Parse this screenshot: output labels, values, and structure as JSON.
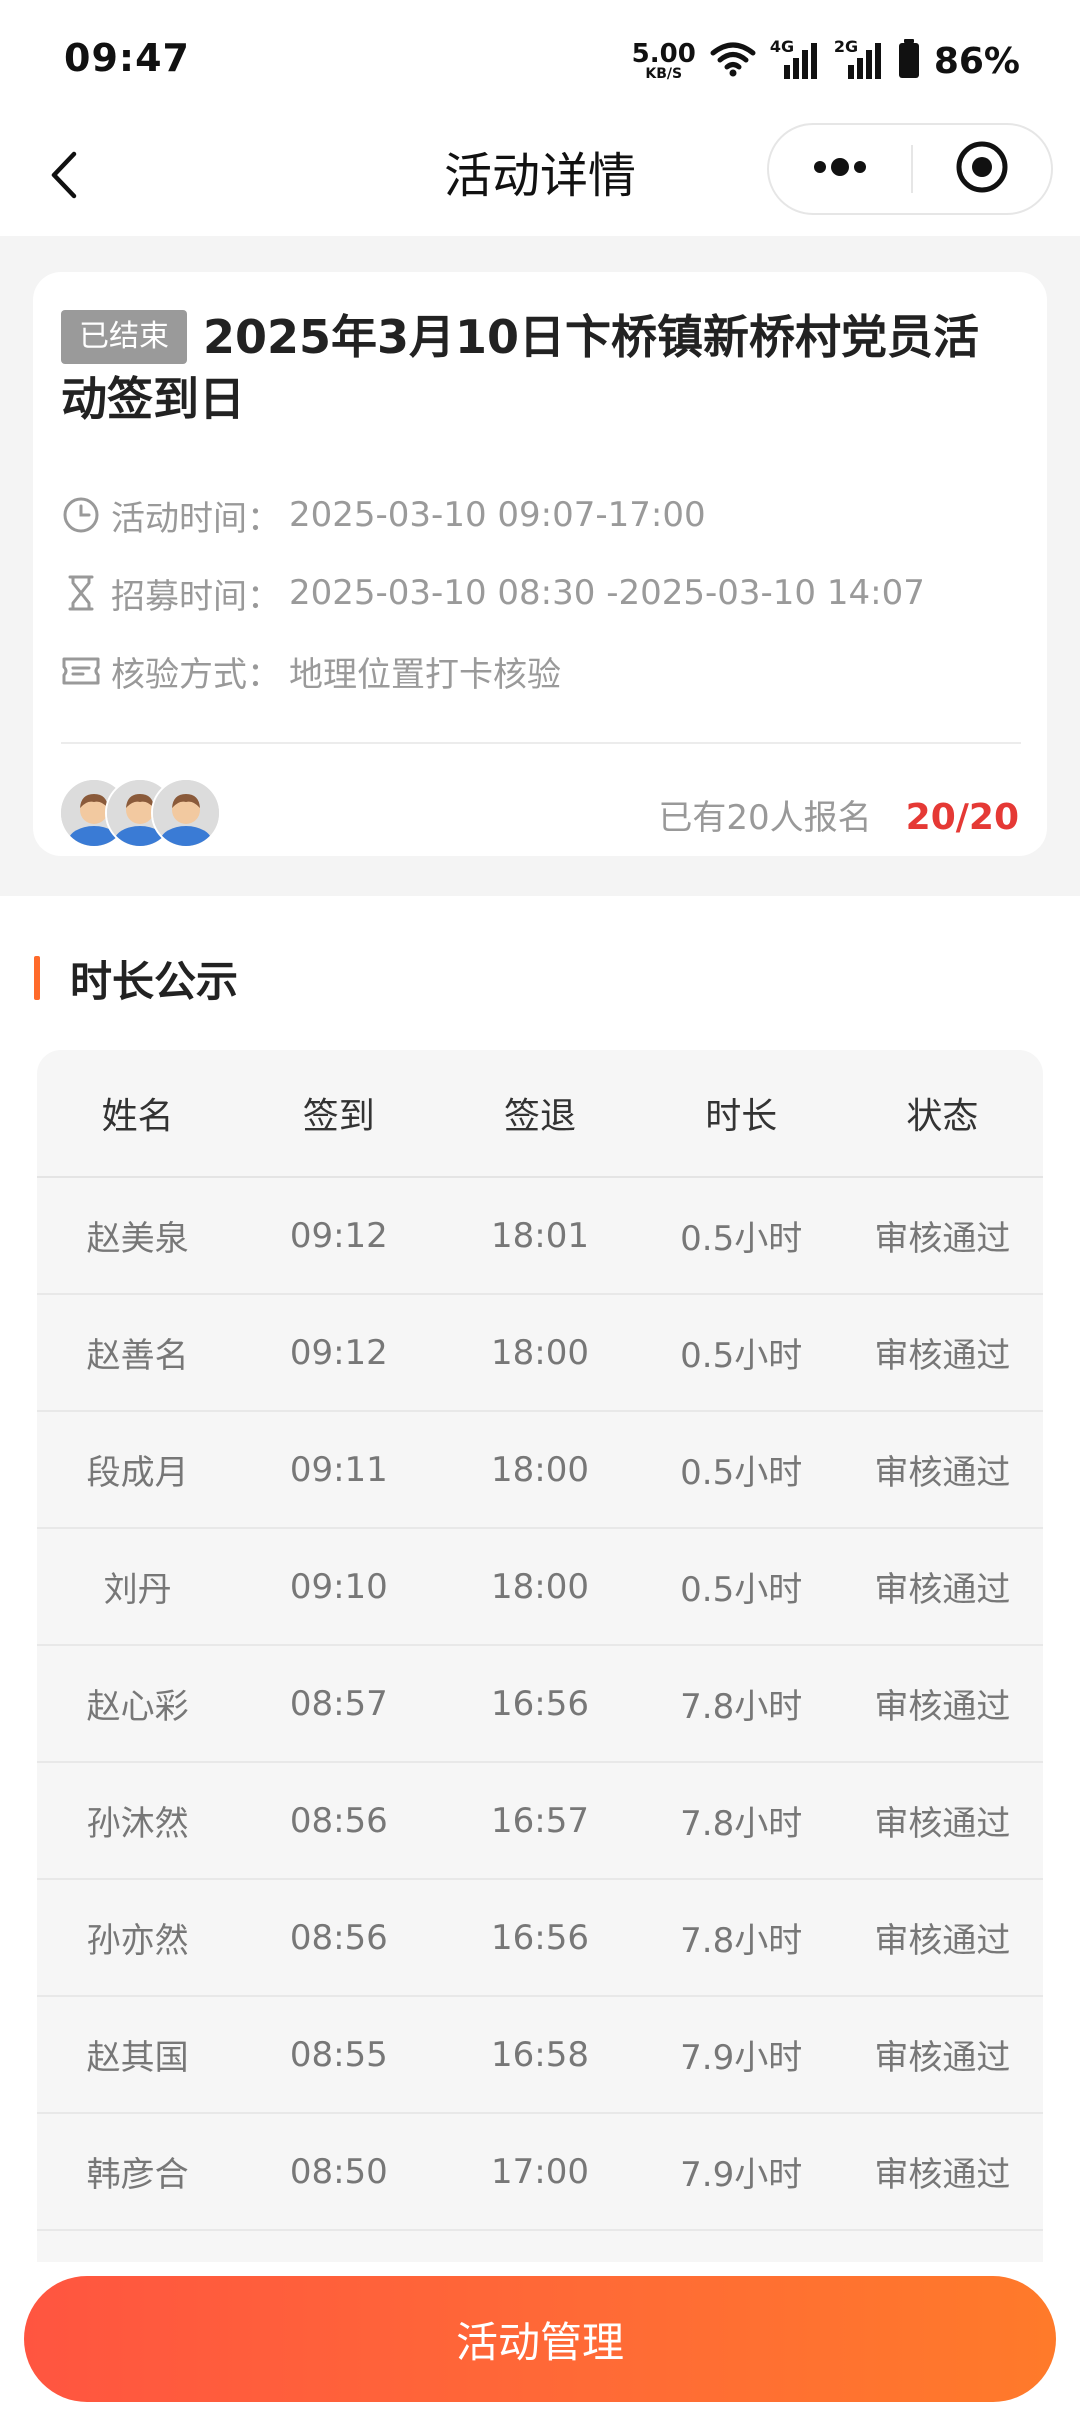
{
  "status_bar": {
    "time": "09:47",
    "net_speed": "5.00",
    "net_unit": "KB/S",
    "sig1": "4G",
    "sig2": "2G",
    "battery": "86%"
  },
  "nav": {
    "title": "活动详情",
    "back_icon": "chevron-left-icon",
    "more_icon": "more-dots-icon",
    "target_icon": "target-icon"
  },
  "activity": {
    "badge": "已结束",
    "title": "2025年3月10日卞桥镇新桥村党员活动签到日",
    "rows": [
      {
        "icon": "clock-icon",
        "label": "活动时间：",
        "value": "2025-03-10 09:07-17:00"
      },
      {
        "icon": "hourglass-icon",
        "label": "招募时间：",
        "value": "2025-03-10 08:30 -2025-03-10 14:07"
      },
      {
        "icon": "ticket-icon",
        "label": "核验方式：",
        "value": "地理位置打卡核验"
      }
    ],
    "signup_text": "已有20人报名",
    "signup_count": "20/20"
  },
  "section": {
    "title": "时长公示"
  },
  "table": {
    "headers": [
      "姓名",
      "签到",
      "签退",
      "时长",
      "状态"
    ],
    "rows": [
      [
        "赵美泉",
        "09:12",
        "18:01",
        "0.5小时",
        "审核通过"
      ],
      [
        "赵善名",
        "09:12",
        "18:00",
        "0.5小时",
        "审核通过"
      ],
      [
        "段成月",
        "09:11",
        "18:00",
        "0.5小时",
        "审核通过"
      ],
      [
        "刘丹",
        "09:10",
        "18:00",
        "0.5小时",
        "审核通过"
      ],
      [
        "赵心彩",
        "08:57",
        "16:56",
        "7.8小时",
        "审核通过"
      ],
      [
        "孙沐然",
        "08:56",
        "16:57",
        "7.8小时",
        "审核通过"
      ],
      [
        "孙亦然",
        "08:56",
        "16:56",
        "7.8小时",
        "审核通过"
      ],
      [
        "赵其国",
        "08:55",
        "16:58",
        "7.9小时",
        "审核通过"
      ],
      [
        "韩彦合",
        "08:50",
        "17:00",
        "7.9小时",
        "审核通过"
      ]
    ]
  },
  "bottom": {
    "button_label": "活动管理"
  },
  "colors": {
    "accent": "#ff5a3c",
    "count_red": "#e53935",
    "badge_gray": "#9a9a9a"
  }
}
